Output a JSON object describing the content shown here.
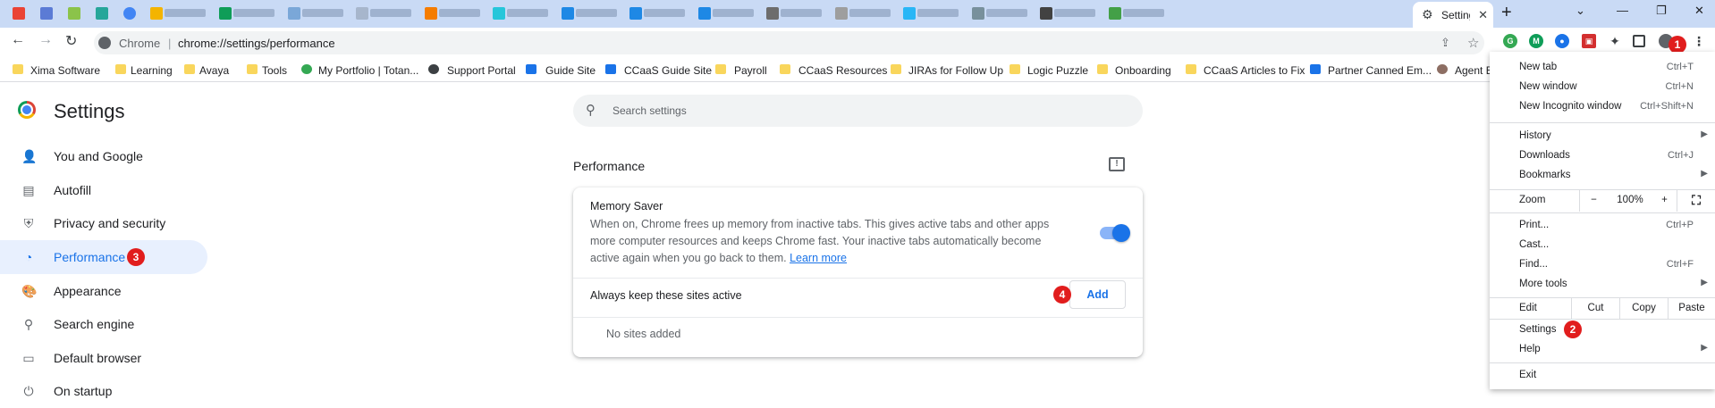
{
  "tabstrip": {
    "active_tab_title": "Settings",
    "new_tab_symbol": "+",
    "close_symbol": "✕",
    "window_controls": [
      "⌄",
      "—",
      "❐",
      "✕"
    ]
  },
  "toolbar": {
    "host_label": "Chrome",
    "separator": "|",
    "url_path": "chrome://settings/performance"
  },
  "bookmarks": [
    "Xima Software",
    "Learning",
    "Avaya",
    "Tools",
    "My Portfolio | Totan...",
    "Support Portal",
    "Guide Site",
    "CCaaS Guide Site",
    "Payroll",
    "CCaaS Resources",
    "JIRAs for Follow Up",
    "Logic Puzzle",
    "Onboarding",
    "CCaaS Articles to Fix",
    "Partner Canned Em...",
    "Agent B"
  ],
  "settings": {
    "title": "Settings",
    "sidebar": [
      {
        "label": "You and Google",
        "icon": "person-icon"
      },
      {
        "label": "Autofill",
        "icon": "clipboard-icon"
      },
      {
        "label": "Privacy and security",
        "icon": "shield-icon"
      },
      {
        "label": "Performance",
        "icon": "speedometer-icon"
      },
      {
        "label": "Appearance",
        "icon": "palette-icon"
      },
      {
        "label": "Search engine",
        "icon": "search-icon"
      },
      {
        "label": "Default browser",
        "icon": "browser-icon"
      },
      {
        "label": "On startup",
        "icon": "power-icon"
      }
    ],
    "search_placeholder": "Search settings",
    "section_title": "Performance",
    "memory_saver": {
      "title": "Memory Saver",
      "description": "When on, Chrome frees up memory from inactive tabs. This gives active tabs and other apps more computer resources and keeps Chrome fast. Your inactive tabs automatically become active again when you go back to them.",
      "learn_more": "Learn more",
      "enabled": true
    },
    "keep_active_label": "Always keep these sites active",
    "add_button": "Add",
    "no_sites": "No sites added"
  },
  "badges": {
    "b1": "1",
    "b2": "2",
    "b3": "3",
    "b4": "4"
  },
  "menu": {
    "new_tab": {
      "label": "New tab",
      "shortcut": "Ctrl+T"
    },
    "new_window": {
      "label": "New window",
      "shortcut": "Ctrl+N"
    },
    "incognito": {
      "label": "New Incognito window",
      "shortcut": "Ctrl+Shift+N"
    },
    "history": {
      "label": "History"
    },
    "downloads": {
      "label": "Downloads",
      "shortcut": "Ctrl+J"
    },
    "bookmarks": {
      "label": "Bookmarks"
    },
    "zoom": {
      "label": "Zoom",
      "minus": "−",
      "value": "100%",
      "plus": "+"
    },
    "print": {
      "label": "Print...",
      "shortcut": "Ctrl+P"
    },
    "cast": {
      "label": "Cast..."
    },
    "find": {
      "label": "Find...",
      "shortcut": "Ctrl+F"
    },
    "more_tools": {
      "label": "More tools"
    },
    "edit": {
      "label": "Edit",
      "cut": "Cut",
      "copy": "Copy",
      "paste": "Paste"
    },
    "settings": {
      "label": "Settings"
    },
    "help": {
      "label": "Help"
    },
    "exit": {
      "label": "Exit"
    }
  },
  "colors": {
    "accent": "#1a73e8",
    "badge": "#e11d1d",
    "tabstrip": "#c9daf5",
    "sidebar_active": "#e8f0fe"
  }
}
